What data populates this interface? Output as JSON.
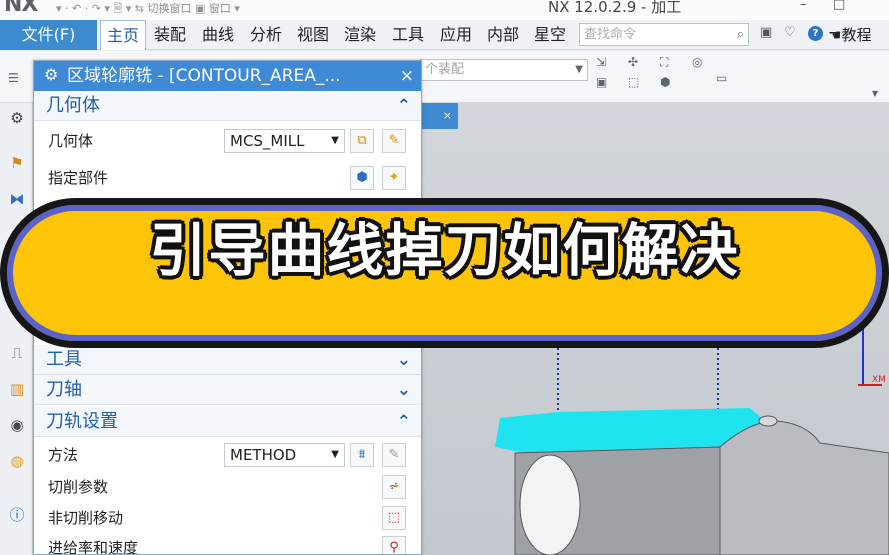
{
  "titlebar": {
    "app_logo": "NX",
    "quick_access": "▾ · ↶ · ↷ ▾ 🗎 ▾   ⇆ 切换窗口   ▣ 窗口 ▾",
    "window_title": "NX 12.0.2.9 - 加工",
    "minimize": "–",
    "maximize": "□"
  },
  "ribbon": {
    "file_tab": "文件(F)",
    "tabs": [
      "主页",
      "装配",
      "曲线",
      "分析",
      "视图",
      "渲染",
      "工具",
      "应用",
      "内部",
      "星空"
    ],
    "active_tab": "主页",
    "search_placeholder": "查找命令",
    "tutorial_label": "教程"
  },
  "toolbar": {
    "assembly_combo": "个装配"
  },
  "graphics": {
    "tab_close": "×",
    "axis_label": "XM"
  },
  "dialog": {
    "title": "区域轮廓铣 - [CONTOUR_AREA_...",
    "close": "×",
    "sections": {
      "geometry": "几何体",
      "tool": "工具",
      "tool_axis": "刀轴",
      "path_settings": "刀轨设置"
    },
    "rows": {
      "geometry_label": "几何体",
      "geometry_value": "MCS_MILL",
      "specify_part": "指定部件",
      "method_label": "方法",
      "method_value": "METHOD",
      "cut_params": "切削参数",
      "non_cut_moves": "非切削移动",
      "feeds_speeds": "进给率和速度"
    }
  },
  "banner": {
    "text": "引导曲线掉刀如何解决"
  },
  "colors": {
    "accent_blue": "#3e8ad4",
    "banner_yellow": "#fdc408",
    "banner_ring": "#5b62c8",
    "cyan_surface": "#1fe3ee"
  }
}
